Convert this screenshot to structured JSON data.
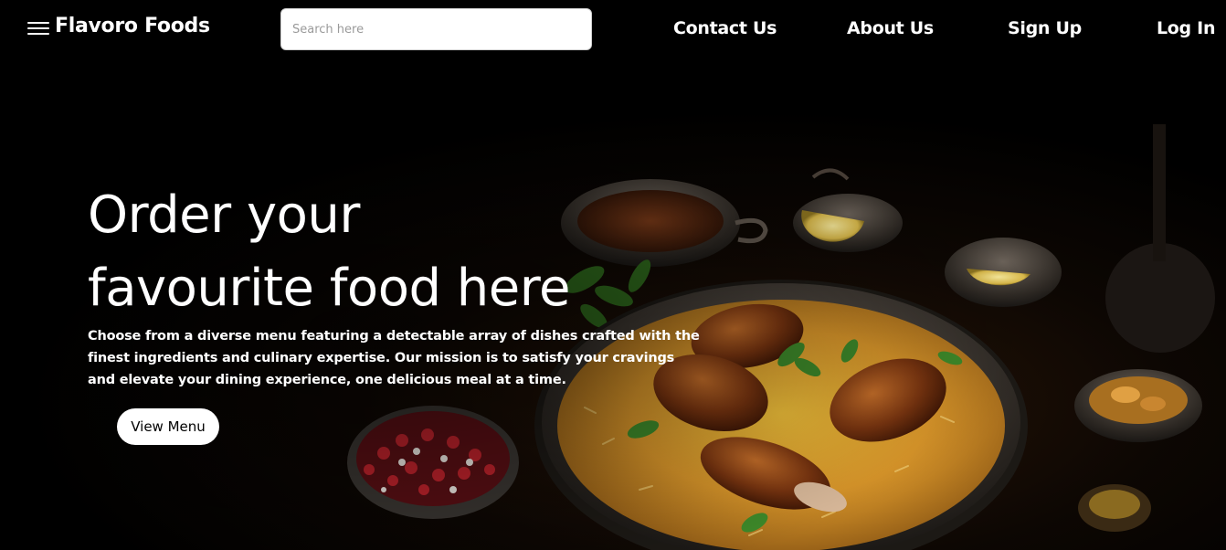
{
  "navbar": {
    "menu_icon": "hamburger-menu-icon",
    "brand": "Flavoro Foods",
    "search": {
      "placeholder": "Search here",
      "value": ""
    },
    "links": [
      "Contact Us",
      "About Us",
      "Sign Up",
      "Log In"
    ]
  },
  "hero": {
    "headline_line1": "Order your",
    "headline_line2": "favourite food here",
    "description": "Choose from a diverse menu featuring a detectable array of dishes crafted with the finest ingredients and culinary expertise. Our mission is to satisfy your cravings and elevate your dining experience, one delicious meal at a time.",
    "cta_label": "View Menu"
  },
  "colors": {
    "background": "#000000",
    "text": "#ffffff",
    "button_bg": "#ffffff",
    "button_text": "#000000"
  }
}
